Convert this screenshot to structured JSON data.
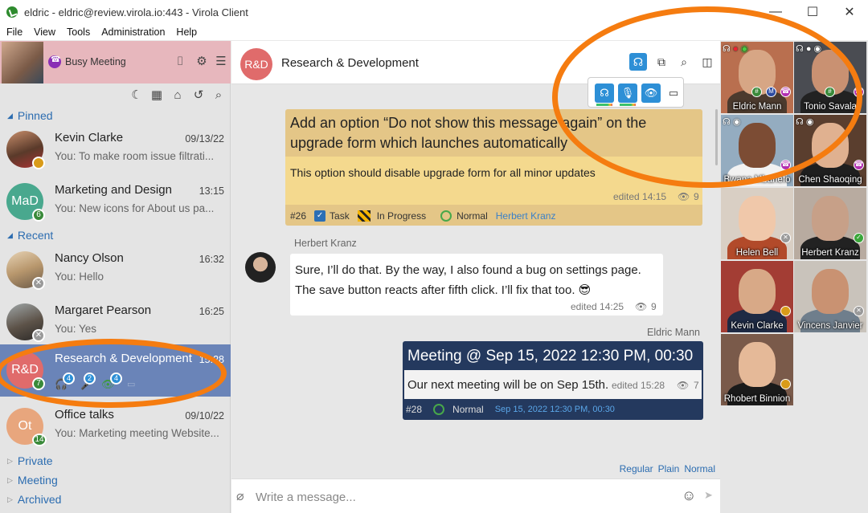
{
  "window": {
    "title": "eldric - eldric@review.virola.io:443 - Virola Client",
    "minimize": "—",
    "maximize": "☐",
    "close": "✕"
  },
  "menu": [
    "File",
    "View",
    "Tools",
    "Administration",
    "Help"
  ],
  "profile": {
    "status_text": "Busy Meeting"
  },
  "sections": {
    "pinned": "Pinned",
    "recent": "Recent",
    "private": "Private",
    "meeting": "Meeting",
    "archived": "Archived"
  },
  "contacts": [
    {
      "name": "Kevin Clarke",
      "date": "09/13/22",
      "sub": "You: To make room issue filtrati..."
    },
    {
      "name": "Marketing and Design",
      "initials": "MaD",
      "date": "13:15",
      "sub": "You: New icons for About us pa...",
      "badge": "6"
    },
    {
      "name": "Nancy Olson",
      "date": "16:32",
      "sub": "You: Hello"
    },
    {
      "name": "Margaret Pearson",
      "date": "16:25",
      "sub": "You: Yes"
    },
    {
      "name": "Research & Development",
      "initials": "R&D",
      "date": "15:28",
      "badge": "7",
      "counts": [
        "4",
        "2",
        "4"
      ]
    },
    {
      "name": "Office talks",
      "initials": "Ot",
      "date": "09/10/22",
      "sub": "You: Marketing meeting Website...",
      "badge": "14"
    }
  ],
  "chat": {
    "avatar": "R&D",
    "title": "Research & Development",
    "messages": {
      "task": {
        "title": "Add an option “Do not show this message again” on the upgrade form which launches automatically",
        "body": "This option should disable upgrade form for all minor updates",
        "edited": "edited 14:15",
        "views": "9",
        "id": "#26",
        "type": "Task",
        "state": "In Progress",
        "priority": "Normal",
        "assignee": "Herbert Kranz"
      },
      "reply": {
        "sender": "Herbert Kranz",
        "text": "Sure, I’ll do that. By the way, I also found a bug on settings page. The save button reacts after fifth click. I’ll fix that too. 😎",
        "edited": "edited 14:25",
        "views": "9"
      },
      "meeting": {
        "sender": "Eldric Mann",
        "title": "Meeting @ Sep 15, 2022 12:30 PM, 00:30",
        "body": "Our next meeting will be on Sep 15th.",
        "edited": "edited 15:28",
        "views": "7",
        "id": "#28",
        "priority": "Normal",
        "when": "Sep 15, 2022 12:30 PM, 00:30"
      }
    },
    "format": [
      "Regular",
      "Plain",
      "Normal"
    ],
    "input_placeholder": "Write a message..."
  },
  "participants": [
    {
      "name": "Eldric Mann"
    },
    {
      "name": "Tonio Savala"
    },
    {
      "name": "Bwana Mbanefo"
    },
    {
      "name": "Chen Shaoqing"
    },
    {
      "name": "Helen Bell"
    },
    {
      "name": "Herbert Kranz"
    },
    {
      "name": "Kevin Clarke"
    },
    {
      "name": "Vincens Janvier"
    },
    {
      "name": "Rhobert Binnion"
    }
  ],
  "colors": {
    "accent": "#2d8fd6",
    "highlight": "#f57c10",
    "task_bg": "#e4c687",
    "meeting_bg": "#24395e",
    "active_row": "#6a84b8"
  }
}
